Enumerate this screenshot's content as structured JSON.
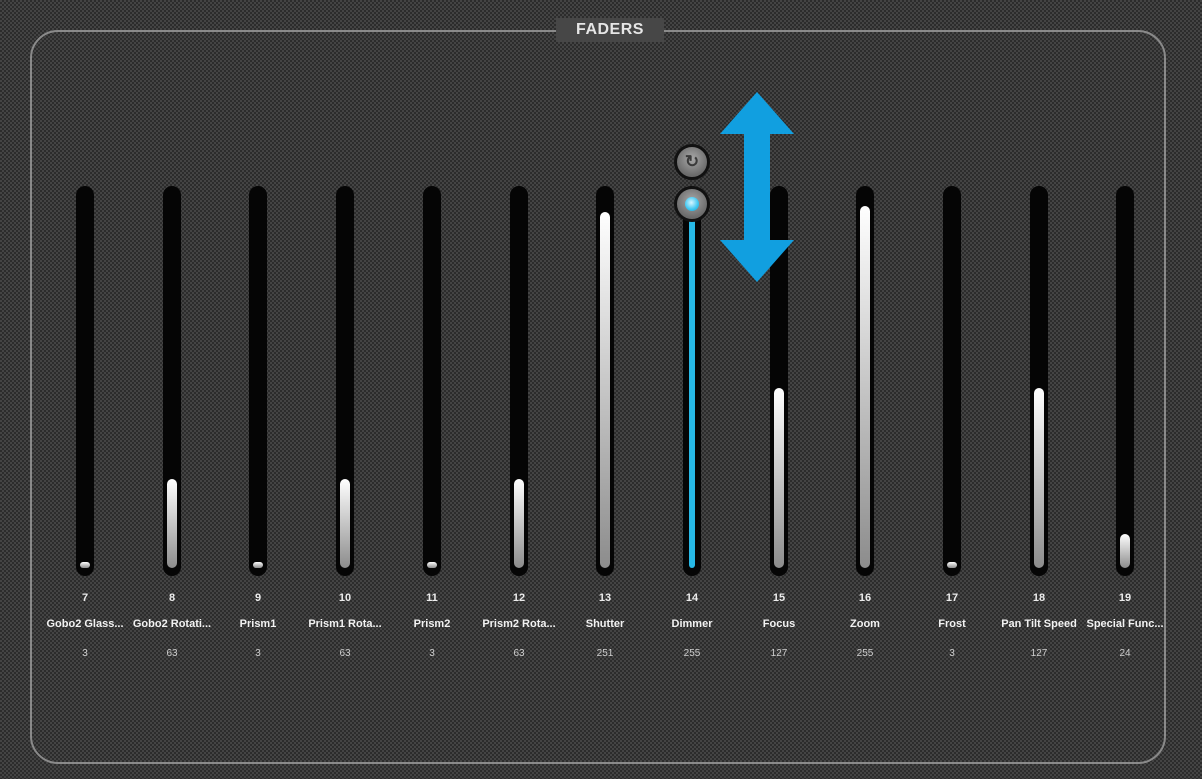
{
  "panel": {
    "title": "FADERS"
  },
  "faders": [
    {
      "number": "7",
      "label": "Gobo2 Glass...",
      "value": "3",
      "level": 0.012
    },
    {
      "number": "8",
      "label": "Gobo2 Rotati...",
      "value": "63",
      "level": 0.247
    },
    {
      "number": "9",
      "label": "Prism1",
      "value": "3",
      "level": 0.012
    },
    {
      "number": "10",
      "label": "Prism1 Rota...",
      "value": "63",
      "level": 0.247
    },
    {
      "number": "11",
      "label": "Prism2",
      "value": "3",
      "level": 0.012
    },
    {
      "number": "12",
      "label": "Prism2 Rota...",
      "value": "63",
      "level": 0.247
    },
    {
      "number": "13",
      "label": "Shutter",
      "value": "251",
      "level": 0.984
    },
    {
      "number": "14",
      "label": "Dimmer",
      "value": "255",
      "level": 1.0,
      "active": true
    },
    {
      "number": "15",
      "label": "Focus",
      "value": "127",
      "level": 0.498
    },
    {
      "number": "16",
      "label": "Zoom",
      "value": "255",
      "level": 1.0
    },
    {
      "number": "17",
      "label": "Frost",
      "value": "3",
      "level": 0.012
    },
    {
      "number": "18",
      "label": "Pan Tilt Speed",
      "value": "127",
      "level": 0.498
    },
    {
      "number": "19",
      "label": "Special Func...",
      "value": "24",
      "level": 0.094
    }
  ],
  "icons": {
    "reset": "reset-icon",
    "drag_arrow": "vertical-drag-arrow-icon"
  },
  "colors": {
    "active": "#27b9e6",
    "arrow": "#119fe0"
  }
}
